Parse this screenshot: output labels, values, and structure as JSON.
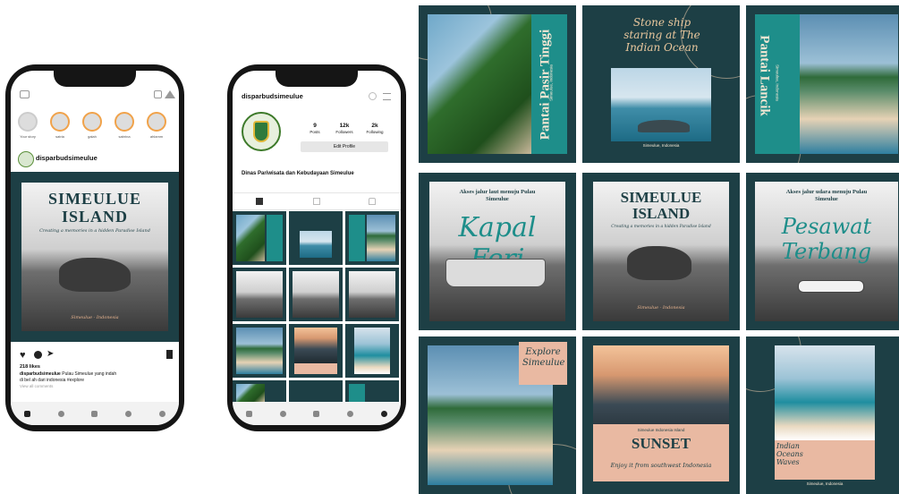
{
  "phone1": {
    "stories": [
      "Your story",
      "satria",
      "galah",
      "sabrina",
      "ahlamm"
    ],
    "profile_name": "disparbudsimeulue",
    "post": {
      "title_line1": "SIMEULUE",
      "title_line2": "ISLAND",
      "tagline": "Creating a memories in a hidden Paradise Island",
      "signature": "Simeulue - Indonesia"
    },
    "likes": "218 likes",
    "caption_user": "disparbudsimeulue",
    "caption_text": "Pulau Simeulue yang indah",
    "caption_tags": "di bel ah dari indonesia #explore",
    "view_comments": "View all comments"
  },
  "phone2": {
    "username": "disparbudsimeulue",
    "posts_count": "9",
    "posts_label": "Posts",
    "followers_count": "12k",
    "followers_label": "Followers",
    "following_count": "2k",
    "following_label": "Following",
    "edit_profile": "Edit Profile",
    "bio_name": "Dinas Pariwisata dan Kebudayaan Simeulue"
  },
  "grid": {
    "t1": {
      "title": "Pantai Pasir Tinggi",
      "sub": "Simeulue, Indonesia"
    },
    "t2": {
      "title": "Stone ship staring at The Indian Ocean",
      "sub": "Simeulue, Indonesia"
    },
    "t3": {
      "title": "Pantai Lancik",
      "sub": "Simeulue, Indonesia"
    },
    "t4": {
      "heading": "Akses jalur laut menuju Pulau Simeulue",
      "title": "Kapal Feri"
    },
    "t5": {
      "title_line1": "SIMEULUE",
      "title_line2": "ISLAND",
      "tagline": "Creating a memories in a hidden Paradise Island",
      "signature": "Simeulue - Indonesia"
    },
    "t6": {
      "heading": "Akses jalur udara menuju Pulau Simeulue",
      "title_line1": "Pesawat",
      "title_line2": "Terbang"
    },
    "t7": {
      "title": "Explore Simeulue"
    },
    "t8": {
      "small": "Simeulue Indonesia Island",
      "title": "SUNSET",
      "sub": "Enjoy it from southwest Indonesia"
    },
    "t9": {
      "title": "Indian Oceans Waves",
      "sub": "Simeulue, Indonesia"
    }
  }
}
